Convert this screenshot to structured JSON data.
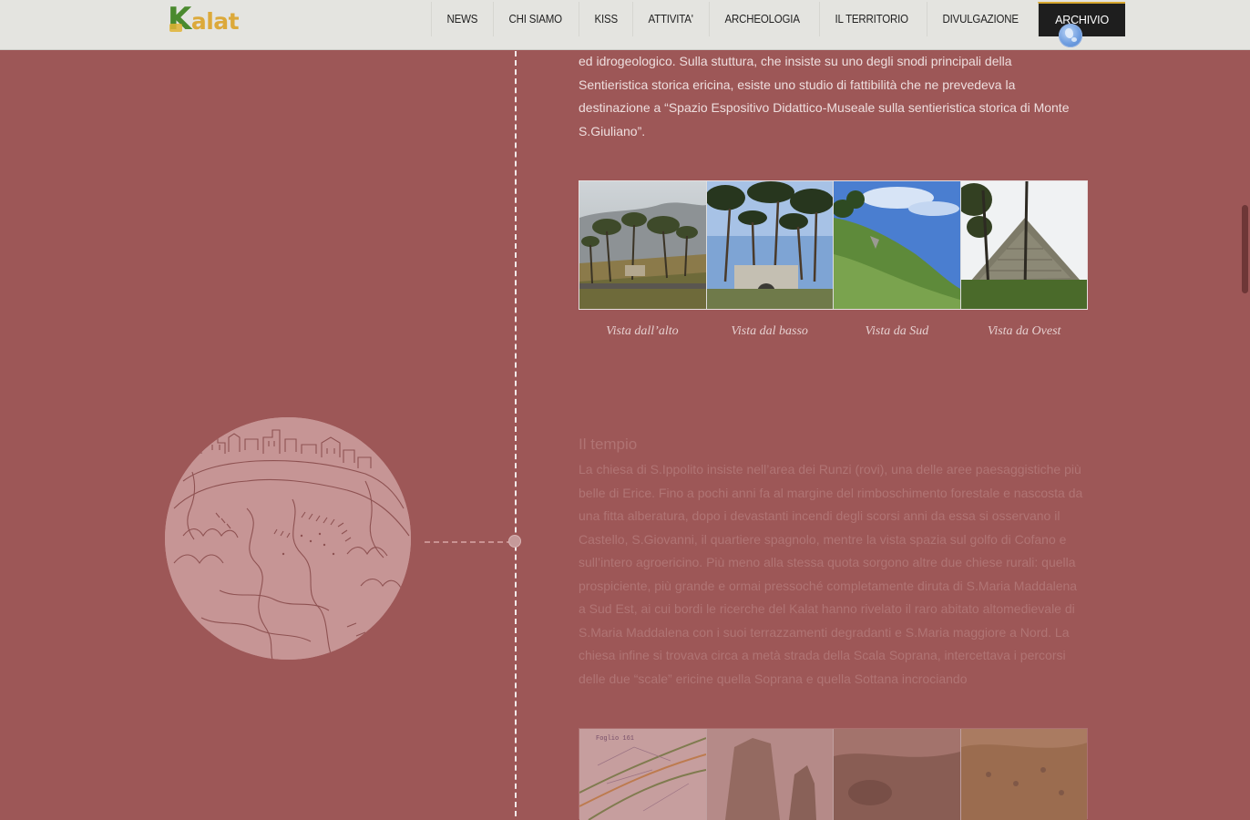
{
  "logo": {
    "first": "K",
    "rest": "alat"
  },
  "nav": {
    "items": [
      {
        "label": "NEWS"
      },
      {
        "label": "CHI SIAMO"
      },
      {
        "label": "KISS"
      },
      {
        "label": "ATTIVITA'"
      },
      {
        "label": "ARCHEOLOGIA"
      },
      {
        "label": "IL TERRITORIO"
      },
      {
        "label": "DIVULGAZIONE"
      },
      {
        "label": "ARCHIVIO",
        "active": true
      }
    ]
  },
  "intro": {
    "lines": [
      "ed idrogeologico. Sulla stuttura, che insiste su uno degli snodi principali della",
      "Sentieristica storica ericina, esiste uno studio di fattibilità che ne prevedeva la",
      "destinazione a “Spazio Espositivo Didattico-Museale sulla sentieristica storica di Monte",
      "S.Giuliano”."
    ]
  },
  "gallery": {
    "captions": [
      "Vista dall’alto",
      "Vista dal basso",
      "Vista da Sud",
      "Vista da Ovest"
    ]
  },
  "section": {
    "title": "Il tempio",
    "lines": [
      "La chiesa di S.Ippolito insiste nell’area dei Runzi (rovi), una delle aree paesaggistiche più",
      "belle di Erice. Fino a pochi anni fa al margine del rimboschimento forestale e nascosta da",
      "una fitta alberatura, dopo i devastanti incendi degli scorsi anni da essa si osservano il",
      "Castello, S.Giovanni, il quartiere spagnolo, mentre la vista spazia sul golfo di Cofano e",
      "sull’intero agroericino. Più meno alla stessa quota sorgono altre due chiese rurali: quella",
      "prospiciente, più grande e ormai pressoché completamente diruta di S.Maria Maddalena",
      "a Sud Est, ai cui bordi le ricerche del Kalat hanno rivelato il raro abitato altomedievale di",
      "S.Maria Maddalena con i suoi terrazzamenti degradanti e S.Maria maggiore a Nord. La",
      "chiesa infine  si trovava circa a metà strada della Scala Soprana, intercettava i percorsi",
      "delle due “scale” ericine quella Soprana e quella Sottana  incrociando"
    ]
  },
  "map_thumb": {
    "label": "Foglio 161"
  },
  "icons": {
    "language": "globe-icon"
  },
  "colors": {
    "background": "#9d5757",
    "nav_active": "#1e1e1e",
    "logo_green": "#4a8a2e",
    "logo_gold": "#dca93a"
  }
}
